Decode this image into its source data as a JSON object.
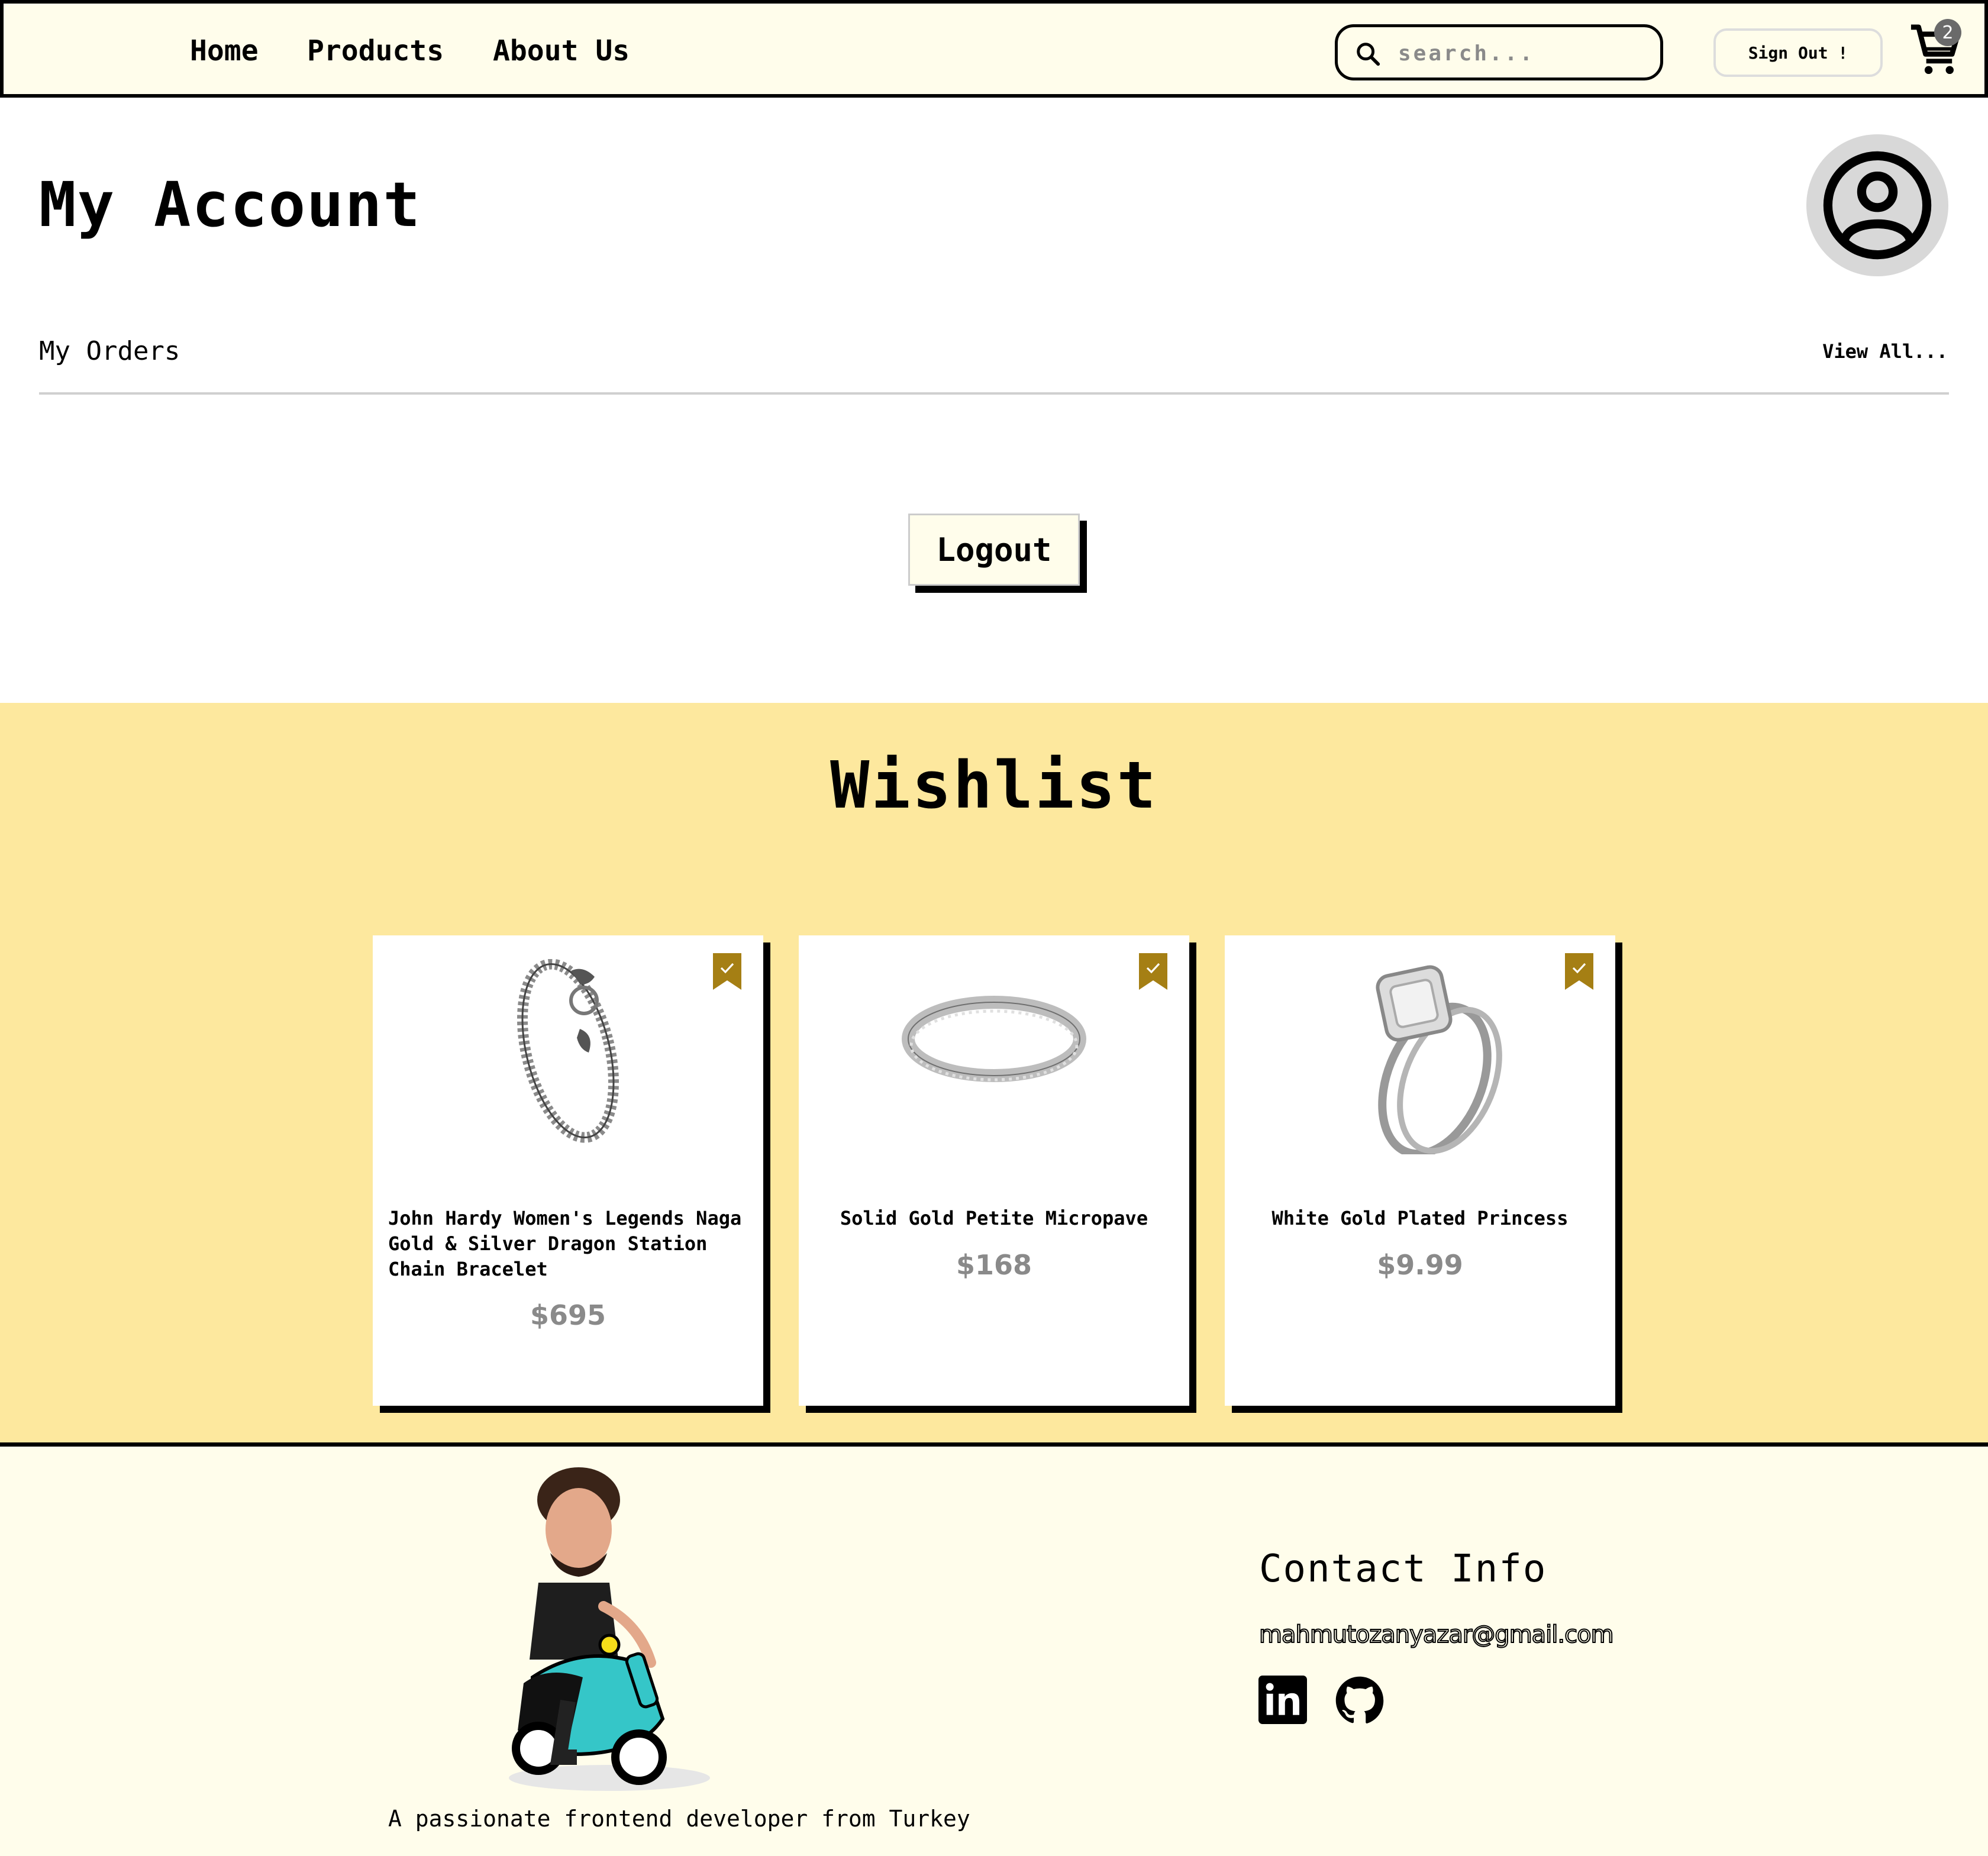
{
  "nav": {
    "links": [
      "Home",
      "Products",
      "About Us"
    ],
    "search_placeholder": "search...",
    "signout_label": "Sign Out !",
    "cart_count": "2"
  },
  "account": {
    "title": "My Account",
    "orders_title": "My Orders",
    "view_all": "View All...",
    "logout_label": "Logout"
  },
  "wishlist": {
    "title": "Wishlist",
    "items": [
      {
        "name": "John Hardy Women's Legends Naga Gold & Silver Dragon Station Chain Bracelet",
        "price": "$695",
        "image": "bracelet"
      },
      {
        "name": "Solid Gold Petite Micropave",
        "price": "$168",
        "image": "ring"
      },
      {
        "name": "White Gold Plated Princess",
        "price": "$9.99",
        "image": "princess-ring"
      }
    ]
  },
  "footer": {
    "tagline": "A passionate frontend developer from Turkey",
    "contact_title": "Contact Info",
    "email": "mahmutozanyazar@gmail.com",
    "social": [
      "linkedin-icon",
      "github-icon"
    ]
  },
  "colors": {
    "nav_bg": "#fffdeb",
    "wishlist_bg": "#fde89e",
    "bookmark": "#a57f14",
    "price": "#8a8a8a"
  }
}
